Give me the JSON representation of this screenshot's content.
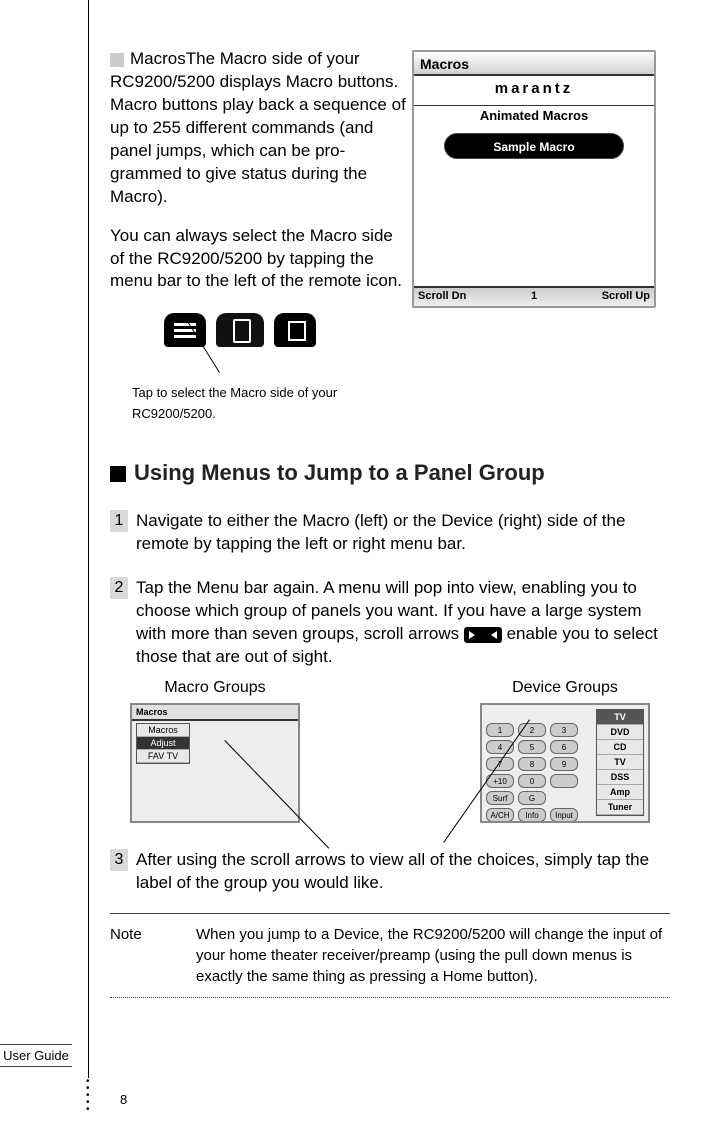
{
  "section1": {
    "label": "Macros",
    "para1": "The Macro side of your RC9200/5200  displays Macro buttons. Macro buttons play back a sequence of up to 255 different commands (and panel jumps, which can be pro-grammed to give status during the Macro).",
    "para2": "You can always select the Macro side of the RC9200/5200  by tapping the menu bar to the left of the remote icon.",
    "tap_caption": "Tap to select the Macro side of your RC9200/5200."
  },
  "device_shot": {
    "top": "Macros",
    "brand": "marantz",
    "subtitle": "Animated Macros",
    "button": "Sample Macro",
    "bottom_left": "Scroll Dn",
    "bottom_center": "1",
    "bottom_right": "Scroll Up"
  },
  "heading2": "Using Menus to Jump to a Panel Group",
  "steps": {
    "s1_num": "1",
    "s1": "Navigate to either the Macro (left) or the Device (right) side of the remote by tapping the left or right menu bar.",
    "s2_num": "2",
    "s2a": "Tap the Menu bar again. A menu will pop into view, enabling you to choose which group of panels you want. If you have a large system with more than seven groups, scroll arrows ",
    "s2b": " enable you to select those that are out of sight.",
    "s3_num": "3",
    "s3": "After using the scroll arrows to view all of the choices, simply tap the label of the group you would like."
  },
  "groups": {
    "macro_label": "Macro Groups",
    "device_label": "Device Groups",
    "macro_menu": {
      "top": "Macros",
      "items": [
        "Macros",
        "Adjust",
        "FAV TV"
      ]
    },
    "device_menu": {
      "top": "TV",
      "items": [
        "DVD",
        "CD",
        "TV",
        "DSS",
        "Amp",
        "Tuner"
      ]
    }
  },
  "note": {
    "label": "Note",
    "text": "When you jump to a Device, the RC9200/5200 will change the input of your home theater receiver/preamp (using the pull down menus is exactly the same thing as pressing a Home button)."
  },
  "footer": {
    "user_guide": "User Guide",
    "page": "8"
  }
}
